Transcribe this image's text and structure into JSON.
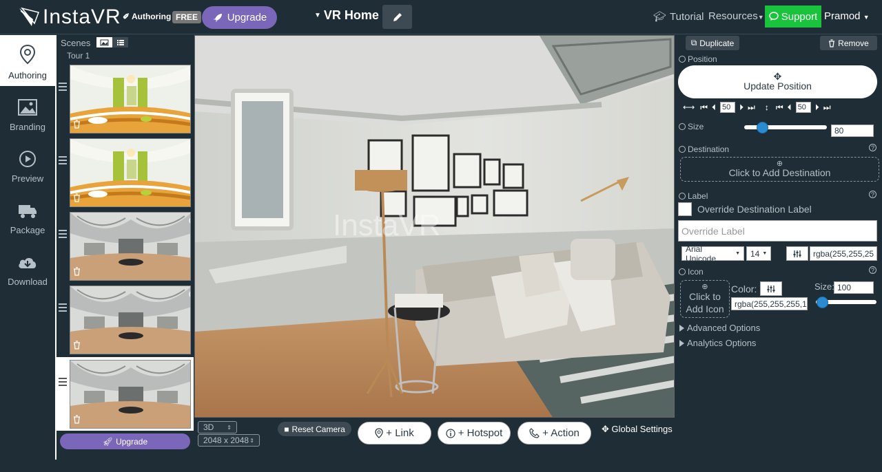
{
  "app": {
    "logo_text": "InstaVR",
    "authoring_tag": "Authoring",
    "plan_badge": "FREE",
    "upgrade_label": "Upgrade",
    "project_title": "VR Home",
    "accent_color": "#7a67b9"
  },
  "header": {
    "tutorial": "Tutorial",
    "resources": "Resources",
    "support": "Support",
    "user": "Pramod"
  },
  "nav": {
    "items": [
      {
        "label": "Authoring",
        "icon": "map-pin-icon"
      },
      {
        "label": "Branding",
        "icon": "image-icon"
      },
      {
        "label": "Preview",
        "icon": "play-icon"
      },
      {
        "label": "Package",
        "icon": "truck-icon"
      },
      {
        "label": "Download",
        "icon": "cloud-download-icon"
      }
    ]
  },
  "scenes": {
    "header": "Scenes",
    "tour_label": "Tour 1",
    "upgrade_label": "Upgrade"
  },
  "viewer": {
    "watermark": "InstaVR",
    "mode": "3D",
    "resolution": "2048 x 2048",
    "reset_camera": "Reset Camera",
    "add_link": "+ Link",
    "add_hotspot": "+ Hotspot",
    "add_action": "+ Action",
    "global_settings": "Global Settings"
  },
  "props": {
    "duplicate": "Duplicate",
    "remove": "Remove",
    "position_label": "Position",
    "update_position": "Update Position",
    "pos_x": "50",
    "pos_y": "50",
    "size_label": "Size",
    "size_value": "80",
    "size_fraction": 0.22,
    "destination_label": "Destination",
    "add_destination": "Click to Add Destination",
    "label_label": "Label",
    "override_dest_label": "Override Destination Label",
    "override_label_placeholder": "Override Label",
    "font_family": "Arial Unicode",
    "font_size": "14",
    "label_color": "rgba(255,255,25",
    "icon_label": "Icon",
    "add_icon_line1": "Click to",
    "add_icon_line2": "Add Icon",
    "color_label": "Color:",
    "icon_color": "rgba(255,255,255,1",
    "icon_size_label": "Size:",
    "icon_size_value": "100",
    "icon_size_fraction": 0.1,
    "advanced_options": "Advanced Options",
    "analytics_options": "Analytics Options"
  }
}
